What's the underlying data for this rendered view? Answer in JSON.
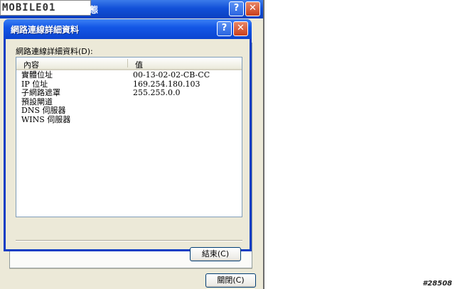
{
  "background_window": {
    "watermark": "MOBILE01",
    "title_fragment": "態",
    "help_glyph": "?",
    "close_glyph": "✕",
    "close_button_label": "關閉(C)"
  },
  "dialog": {
    "title": "網路連線詳細資料",
    "help_glyph": "?",
    "close_glyph": "✕",
    "group_label": "網路連線詳細資料(D):",
    "columns": [
      "內容",
      "值"
    ],
    "rows": [
      {
        "property": "實體位址",
        "value": "00-13-02-02-CB-CC"
      },
      {
        "property": "IP 位址",
        "value": "169.254.180.103"
      },
      {
        "property": "子網路遮罩",
        "value": "255.255.0.0"
      },
      {
        "property": "預設閘道",
        "value": ""
      },
      {
        "property": "DNS 伺服器",
        "value": ""
      },
      {
        "property": "WINS 伺服器",
        "value": ""
      }
    ],
    "close_button_label": "結束(C)"
  },
  "corner_tag": "#28508",
  "colors": {
    "titlebar": "#1457e6",
    "dialog_face": "#ece9d8",
    "close_button": "#c93f1d"
  }
}
